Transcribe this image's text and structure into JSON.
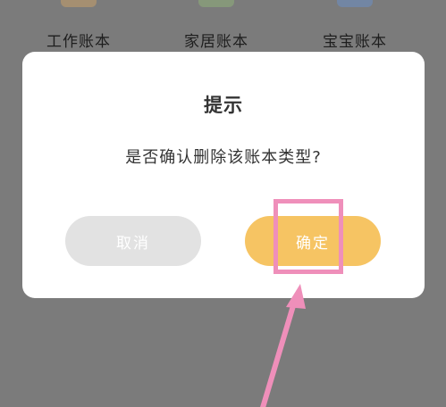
{
  "background_books": [
    {
      "label": "工作账本",
      "icon": "work-book-icon",
      "color": "#c9a06a"
    },
    {
      "label": "家居账本",
      "icon": "home-book-icon",
      "color": "#8fb07a"
    },
    {
      "label": "宝宝账本",
      "icon": "baby-book-icon",
      "color": "#6b8fc7"
    }
  ],
  "dialog": {
    "title": "提示",
    "message": "是否确认删除该账本类型?",
    "cancel_label": "取消",
    "confirm_label": "确定"
  },
  "colors": {
    "overlay": "#7b7b7b",
    "confirm": "#f6c463",
    "cancel": "#e2e2e2",
    "annotation": "#ef8fba"
  }
}
